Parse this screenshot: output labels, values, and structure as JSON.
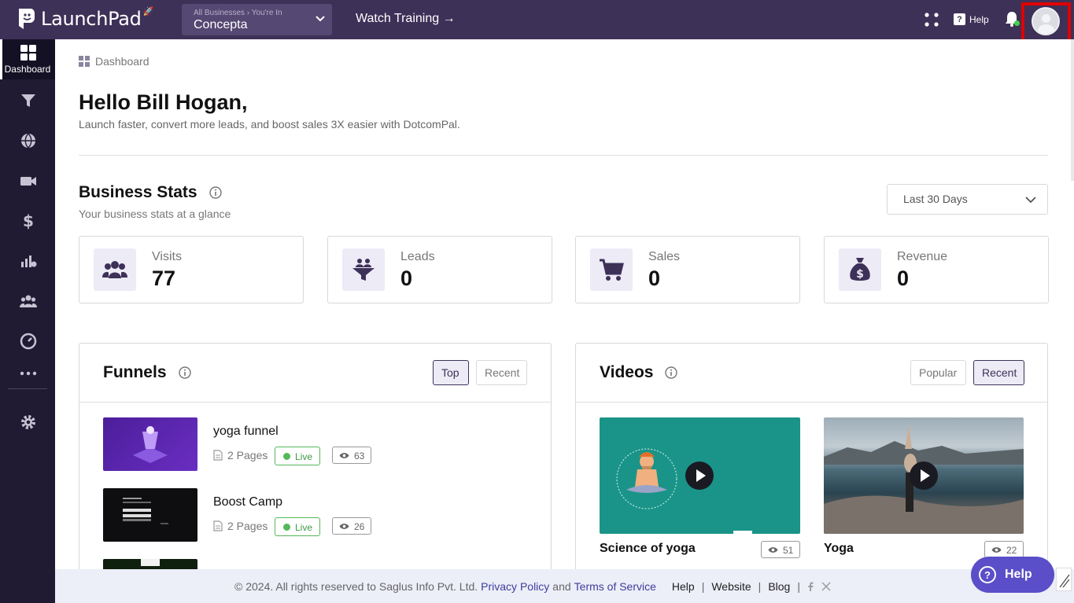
{
  "app": {
    "name": "LaunchPad"
  },
  "topbar": {
    "business_small": "All Businesses › You're In",
    "business_name": "Concepta",
    "watch_training": "Watch Training →",
    "help_label": "Help"
  },
  "sidebar": {
    "items": [
      {
        "label": "Dashboard",
        "icon": "dashboard-icon",
        "active": true
      },
      {
        "icon": "funnel-icon"
      },
      {
        "icon": "globe-icon"
      },
      {
        "icon": "video-icon"
      },
      {
        "icon": "dollar-icon"
      },
      {
        "icon": "analytics-icon"
      },
      {
        "icon": "users-icon"
      },
      {
        "icon": "gauge-icon"
      },
      {
        "icon": "more-icon"
      },
      {
        "icon": "settings-icon"
      }
    ]
  },
  "breadcrumb": {
    "label": "Dashboard"
  },
  "greeting": {
    "title": "Hello Bill Hogan,",
    "subtitle": "Launch faster, convert more leads, and boost sales 3X easier with DotcomPal."
  },
  "business_stats": {
    "title": "Business Stats",
    "subtitle": "Your business stats at a glance",
    "range": "Last 30 Days",
    "stats": [
      {
        "label": "Visits",
        "value": "77",
        "icon": "visitors-icon"
      },
      {
        "label": "Leads",
        "value": "0",
        "icon": "leads-funnel-icon"
      },
      {
        "label": "Sales",
        "value": "0",
        "icon": "cart-icon"
      },
      {
        "label": "Revenue",
        "value": "0",
        "icon": "money-bag-icon"
      }
    ]
  },
  "funnels": {
    "title": "Funnels",
    "tabs": [
      "Top",
      "Recent"
    ],
    "active_tab": "Top",
    "items": [
      {
        "name": "yoga funnel",
        "pages": "2 Pages",
        "status": "Live",
        "views": "63"
      },
      {
        "name": "Boost Camp",
        "pages": "2 Pages",
        "status": "Live",
        "views": "26"
      }
    ]
  },
  "videos": {
    "title": "Videos",
    "tabs": [
      "Popular",
      "Recent"
    ],
    "active_tab": "Recent",
    "items": [
      {
        "title": "Science of yoga",
        "views": "51"
      },
      {
        "title": "Yoga",
        "views": "22"
      }
    ]
  },
  "footer": {
    "copyright": "© 2024. All rights reserved to Saglus Info Pvt. Ltd.",
    "privacy": "Privacy Policy",
    "and": "and",
    "terms": "Terms of Service",
    "help": "Help",
    "website": "Website",
    "blog": "Blog"
  },
  "help_button": {
    "label": "Help"
  },
  "colors": {
    "topbar": "#3e3158",
    "sidebar": "#201b33",
    "accent": "#5a4fc8",
    "live": "#55b85a"
  }
}
